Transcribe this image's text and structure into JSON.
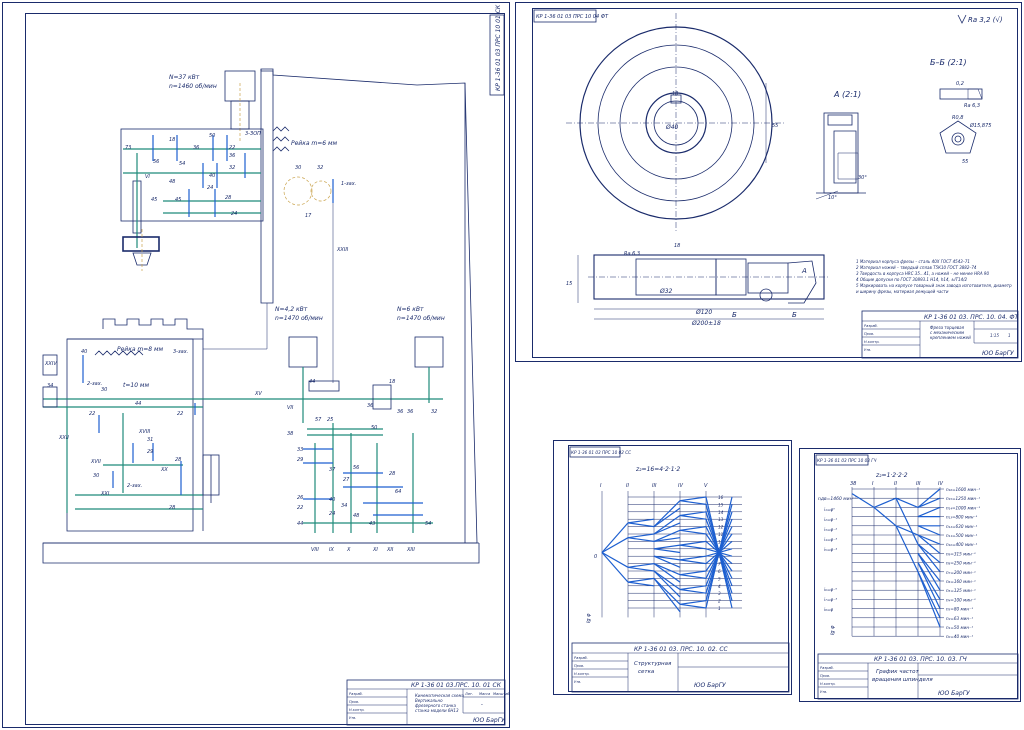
{
  "colors": {
    "ink": "#1a2b6b",
    "green": "#1f8a7a",
    "blue": "#1d5fd0",
    "yellow": "#c9a24a"
  },
  "sheet1": {
    "stamp": "КР 1-36 01 03 ПРС 10 01 СК",
    "title_block": {
      "code": "КР 1-36 01 03.ПРС. 10. 01 СК",
      "name_lines": [
        "Кинематическая схема",
        "Вертикально",
        "фрезерного станка",
        "станка модели 6Н13"
      ],
      "org": "ЮО БарГУ",
      "sheet": "-",
      "sheets": "-"
    },
    "labels": {
      "motor_main": [
        "N=37 кВт",
        "n=1460 об/мин"
      ],
      "rack_top": "Рейка m=6 мм",
      "rack_mid": "Рейка m=8 мм",
      "motor_feed": [
        "N=4,2 кВт",
        "n=1470 об/мин"
      ],
      "motor_aux": [
        "N=6 кВт",
        "n=1470 об/мин"
      ],
      "screw": "t=10 мм",
      "shafts": [
        "VI",
        "VII",
        "VIII",
        "IX",
        "X",
        "XI",
        "XII",
        "XIII",
        "XV",
        "XVII",
        "XVIII",
        "XX",
        "XXI",
        "XXII",
        "XXIII",
        "XXIV"
      ],
      "gears_top": [
        "73",
        "56",
        "18",
        "54",
        "36",
        "50",
        "22",
        "36",
        "32",
        "48",
        "40",
        "28",
        "45",
        "45",
        "24",
        "24",
        "3-ЗОП"
      ],
      "gears_mid": [
        "40",
        "30",
        "34",
        "22",
        "44",
        "22",
        "30",
        "31",
        "29",
        "28",
        "28",
        "2-зах.",
        "3-зах.",
        "1-зах.",
        "2-зах."
      ],
      "gears_feed": [
        "44",
        "38",
        "33",
        "29",
        "37",
        "50",
        "27",
        "26",
        "40",
        "22",
        "24",
        "44",
        "34",
        "48",
        "56",
        "28",
        "64",
        "43",
        "54",
        "57",
        "25",
        "36",
        "36",
        "36",
        "18",
        "32",
        "30",
        "32",
        "17"
      ]
    }
  },
  "sheet2": {
    "stamp": "КР 1-36 01 03 ПРС 10 04 ФТ",
    "roughness": "Ra 3,2 (√)",
    "section_a": "А (2:1)",
    "section_b": "Б–Б (2:1)",
    "dims": [
      "Ø120",
      "Ø200±18",
      "Ø32",
      "Ø40",
      "18",
      "55",
      "15",
      "10°",
      "30°",
      "8°",
      "R0,8",
      "Ø15,875",
      "0,2",
      "Ra 6,3"
    ],
    "notes": [
      "1 Материал корпуса фрезы – сталь 40Х ГОСТ 4543–71",
      "2 Материал ножей – твердый сплав Т5К10 ГОСТ 3882–74",
      "3 Твердость в корпуса HRC 35…41, а ножей – не менее HRA 90",
      "4 Общие допуски по ГОСТ 30893.1 H14, h14, ±IT14/2",
      "5 Маркировать на корпусе товарный знак завода изготовителя, диаметр",
      "  и ширину фрезы, материал режущей части"
    ],
    "title_block": {
      "code": "КР 1-36 01 03. ПРС. 10. 04. ФТ",
      "name_lines": [
        "Фреза торцевая",
        "с механическим",
        "креплением ножей"
      ],
      "org": "ЮО БарГУ",
      "sheet": "1",
      "sheets": "1",
      "scale": "1:15"
    },
    "arrows": [
      "А",
      "Б",
      "Б"
    ]
  },
  "sheet3": {
    "stamp": "КР 1-36 01 03 ПРС 10 02 СС",
    "formula": "z₂=16=4·2·1·2",
    "columns": [
      "I",
      "II",
      "III",
      "IV",
      "V"
    ],
    "rows": [
      "16",
      "15",
      "14",
      "13",
      "12",
      "11",
      "10",
      "9",
      "8",
      "7",
      "6",
      "5",
      "4",
      "3",
      "2",
      "1"
    ],
    "left_tick": "0",
    "axis_label": "lg φ",
    "title_block": {
      "code": "КР 1-36 01 03. ПРС. 10. 02. СС",
      "name_lines": [
        "Структурная",
        "сетка"
      ],
      "org": "ЮО БарГУ",
      "sheet": "-",
      "sheets": "-"
    }
  },
  "sheet4": {
    "stamp": "КР 1-36 01 03 ПРС 10 03 ГЧ",
    "formula": "z₂=1·2·2·2",
    "columns": [
      "38",
      "I",
      "II",
      "III",
      "IV"
    ],
    "left_label": "nдв=1460 мин⁻¹",
    "speeds": [
      "n₁₆=1600 мин⁻¹",
      "n₁₅=1250 мин⁻¹",
      "n₁₄=1000 мин⁻¹",
      "n₁₃=800 мин⁻¹",
      "n₁₂=630 мин⁻¹",
      "n₁₁=500 мин⁻¹",
      "n₁₀=400 мин⁻¹",
      "n₉=315 мин⁻¹",
      "n₈=250 мин⁻¹",
      "n₇=200 мин⁻¹",
      "n₆=160 мин⁻¹",
      "n₅=125 мин⁻¹",
      "n₄=100 мин⁻¹",
      "n₃=80 мин⁻¹",
      "n₂=63 мин⁻¹",
      "n₁=50 мин⁻¹",
      "n₀=40 мин⁻¹"
    ],
    "ratios": [
      "i₁=φ⁰",
      "i₂=φ⁻¹",
      "i₃=φ⁻²",
      "i₄=φ⁻³",
      "i₅=φ⁻⁴",
      "i₆=φ⁻⁶",
      "i₇=φ⁻³",
      "i₈=φ"
    ],
    "axis_label": "lg φ",
    "title_block": {
      "code": "КР 1-36 01 03. ПРС. 10. 03. ГЧ",
      "name_lines": [
        "График частот",
        "вращения шпинделя"
      ],
      "org": "ЮО БарГУ",
      "sheet": "-",
      "sheets": "-"
    }
  },
  "tb_headers": [
    "Изм.",
    "Лист",
    "№ докум.",
    "Подп.",
    "Дата",
    "Разраб.",
    "Пров.",
    "Т.контр.",
    "Н.контр.",
    "Утв.",
    "Лит.",
    "Масса",
    "Масштаб",
    "Лист",
    "Листов"
  ]
}
